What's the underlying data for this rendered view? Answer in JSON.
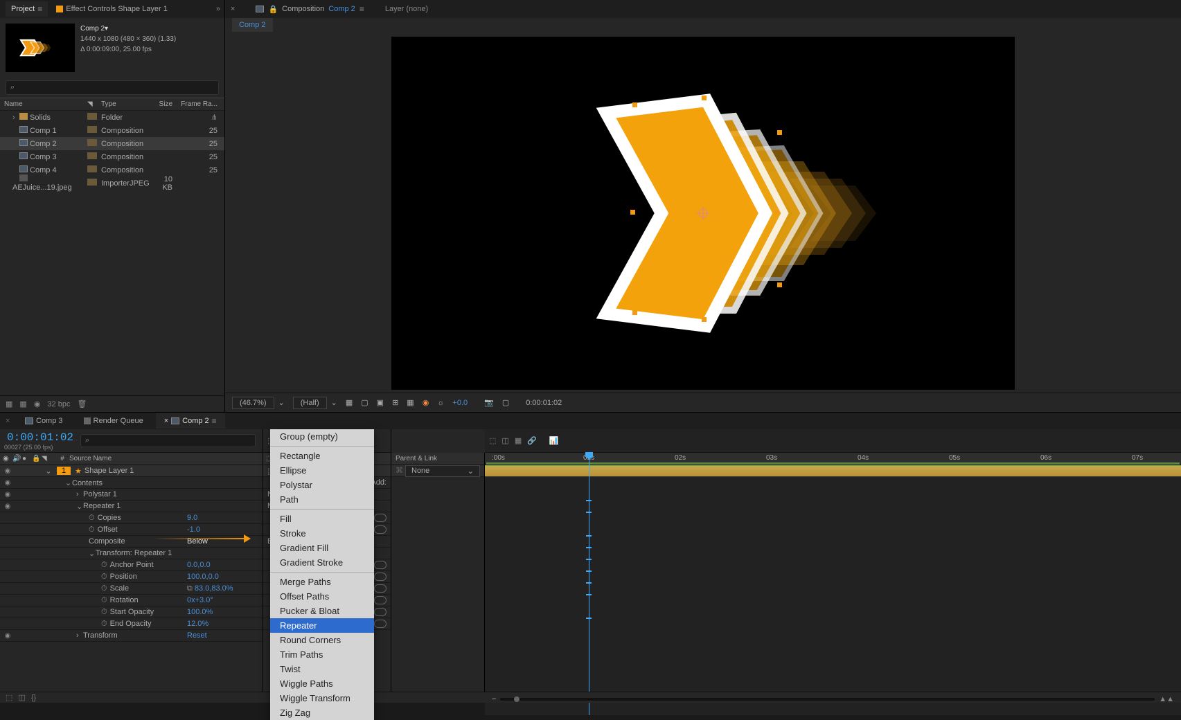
{
  "tabs_top_left": {
    "project": "Project",
    "effect_controls": "Effect Controls Shape Layer 1"
  },
  "composition": {
    "name": "Comp 2",
    "dimensions": "1440 x 1080  (480 × 360) (1.33)",
    "duration": "Δ 0:00:09:00, 25.00 fps"
  },
  "search_placeholder": "⌕",
  "project_columns": {
    "name": "Name",
    "type": "Type",
    "size": "Size",
    "frame_rate": "Frame Ra..."
  },
  "project_items": [
    {
      "name": "Solids",
      "type": "Folder",
      "size": "",
      "fr": "",
      "kind": "folder",
      "expand": true
    },
    {
      "name": "Comp 1",
      "type": "Composition",
      "size": "",
      "fr": "25",
      "kind": "comp"
    },
    {
      "name": "Comp 2",
      "type": "Composition",
      "size": "",
      "fr": "25",
      "kind": "comp",
      "selected": true
    },
    {
      "name": "Comp 3",
      "type": "Composition",
      "size": "",
      "fr": "25",
      "kind": "comp"
    },
    {
      "name": "Comp 4",
      "type": "Composition",
      "size": "",
      "fr": "25",
      "kind": "comp"
    },
    {
      "name": "AEJuice...19.jpeg",
      "type": "ImporterJPEG",
      "size": "10 KB",
      "fr": "",
      "kind": "img"
    }
  ],
  "project_footer_bpc": "32 bpc",
  "viewer": {
    "tab_label_prefix": "Composition",
    "comp_name": "Comp 2",
    "layer_label": "Layer (none)",
    "zoom": "(46.7%)",
    "resolution": "(Half)",
    "exposure": "+0.0",
    "time": "0:00:01:02"
  },
  "timeline": {
    "tabs": [
      {
        "label": "Comp 3",
        "icon": "comp"
      },
      {
        "label": "Render Queue",
        "icon": "gray"
      },
      {
        "label": "Comp 2",
        "icon": "comp",
        "active": true
      }
    ],
    "timecode": "0:00:01:02",
    "timecode_sub": "00027 (25.00 fps)",
    "columns": {
      "hash": "#",
      "source": "Source Name",
      "parent": "Parent & Link"
    },
    "layer": {
      "index": "1",
      "name": "Shape Layer 1",
      "mode": "Normal",
      "parent": "None",
      "add_label": "Add:"
    },
    "contents_label": "Contents",
    "props": [
      {
        "label": "Polystar 1",
        "twirl": true,
        "level": 2
      },
      {
        "label": "Repeater 1",
        "twirl": true,
        "level": 2,
        "open": true
      },
      {
        "label": "Copies",
        "value": "9.0",
        "level": 3,
        "stopwatch": true
      },
      {
        "label": "Offset",
        "value": "-1.0",
        "level": 3,
        "stopwatch": true
      },
      {
        "label": "Composite",
        "value": "Below",
        "level": 3,
        "value_style": "plain"
      },
      {
        "label": "Transform: Repeater 1",
        "twirl": true,
        "level": 3,
        "open": true
      },
      {
        "label": "Anchor Point",
        "value": "0.0,0.0",
        "level": 4,
        "stopwatch": true
      },
      {
        "label": "Position",
        "value": "100.0,0.0",
        "level": 4,
        "stopwatch": true
      },
      {
        "label": "Scale",
        "value": "83.0,83.0%",
        "level": 4,
        "stopwatch": true,
        "chain": true
      },
      {
        "label": "Rotation",
        "value": "0x+3.0°",
        "level": 4,
        "stopwatch": true
      },
      {
        "label": "Start Opacity",
        "value": "100.0%",
        "level": 4,
        "stopwatch": true
      },
      {
        "label": "End Opacity",
        "value": "12.0%",
        "level": 4,
        "stopwatch": true
      },
      {
        "label": "Transform",
        "value": "Reset",
        "twirl": true,
        "level": 2
      }
    ],
    "time_ticks": [
      ":00s",
      "01s",
      "02s",
      "03s",
      "04s",
      "05s",
      "06s",
      "07s"
    ]
  },
  "context_menu": {
    "groups": [
      [
        "Group (empty)"
      ],
      [
        "Rectangle",
        "Ellipse",
        "Polystar",
        "Path"
      ],
      [
        "Fill",
        "Stroke",
        "Gradient Fill",
        "Gradient Stroke"
      ],
      [
        "Merge Paths",
        "Offset Paths",
        "Pucker & Bloat",
        "Repeater",
        "Round Corners",
        "Trim Paths",
        "Twist",
        "Wiggle Paths",
        "Wiggle Transform",
        "Zig Zag"
      ]
    ],
    "highlighted": "Repeater"
  }
}
